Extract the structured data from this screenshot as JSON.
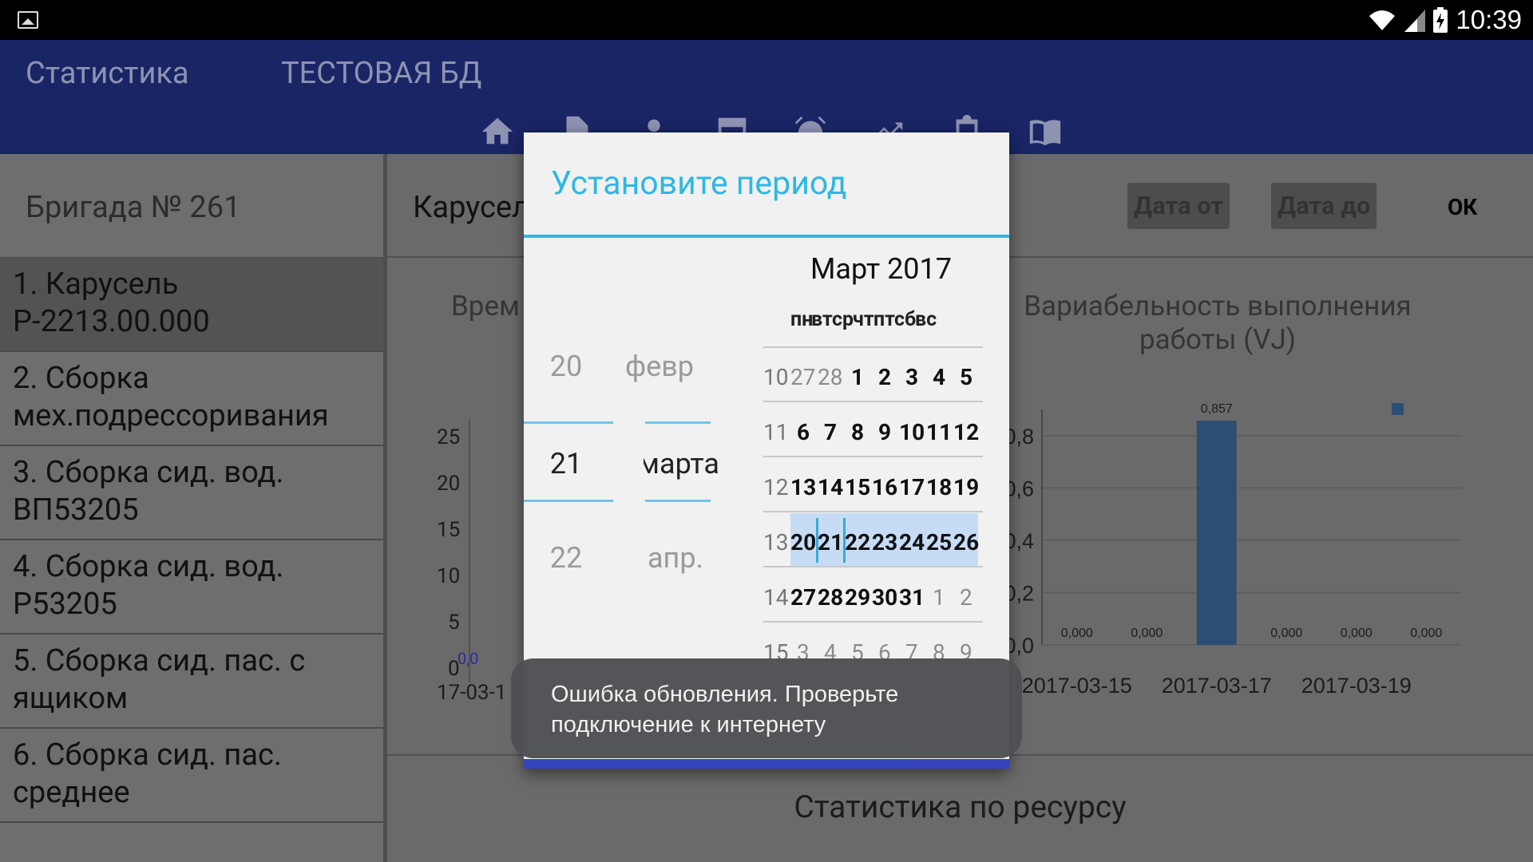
{
  "status_bar": {
    "time": "10:39",
    "icons": [
      "gallery-icon",
      "wifi-icon",
      "signal-icon",
      "battery-charging-icon"
    ]
  },
  "app_bar": {
    "title": "Статистика",
    "db_name": "ТЕСТОВАЯ БД",
    "nav_icons": [
      "home-icon",
      "document-icon",
      "person-icon",
      "window-icon",
      "alarm-icon",
      "trending-up-icon",
      "clipboard-icon",
      "book-icon"
    ]
  },
  "sidebar": {
    "brigade": "Бригада № 261",
    "items": [
      {
        "line1": "1. Карусель",
        "line2": "Р-2213.00.000"
      },
      {
        "line1": "2. Сборка",
        "line2": "мех.подрессоривания"
      },
      {
        "line1": "3. Сборка сид. вод.",
        "line2": "ВП53205"
      },
      {
        "line1": "4. Сборка сид. вод.",
        "line2": "Р53205"
      },
      {
        "line1": "5. Сборка сид. пас. с",
        "line2": "ящиком"
      },
      {
        "line1": "6. Сборка сид. пас.",
        "line2": "среднее"
      }
    ]
  },
  "content": {
    "header": "Карусел",
    "date_from_button": "Дата от",
    "date_to_button": "Дата до",
    "ok_button": "ОК",
    "footer_title": "Статистика по ресурсу",
    "colors": {
      "bar": "#2c4e74",
      "marker": "#2c4e74"
    }
  },
  "chart_data": [
    {
      "type": "bar",
      "title": "Врем",
      "y_ticks": [
        "25",
        "20",
        "15",
        "10",
        "5",
        "0"
      ],
      "x_labels": [
        "17-03-1"
      ],
      "data_labels": [
        "0,0"
      ]
    },
    {
      "type": "bar",
      "title": "Вариабельность выполнения работы (VJ)",
      "y_ticks": [
        "0,8",
        "0,6",
        "0,4",
        "0,2",
        "0,0"
      ],
      "ylim": [
        0,
        0.9
      ],
      "categories": [
        "2017-03-15",
        "2017-03-16",
        "2017-03-17",
        "2017-03-18",
        "2017-03-19",
        "2017-03-20"
      ],
      "x_labels": [
        "2017-03-15",
        "2017-03-17",
        "2017-03-19"
      ],
      "values": [
        0.0,
        0.0,
        0.857,
        0.0,
        0.0,
        0.0
      ],
      "data_labels": [
        "0,000",
        "0,000",
        "0,857",
        "0,000",
        "0,000",
        "0,000"
      ]
    }
  ],
  "dialog": {
    "title": "Установите период",
    "day_picker": {
      "prev": "20",
      "current": "21",
      "next": "22"
    },
    "month_picker": {
      "prev": "февр",
      "current": "марта",
      "next": "апр."
    },
    "calendar": {
      "month_label": "Март 2017",
      "weekdays": [
        "пн",
        "вт",
        "ср",
        "чт",
        "пт",
        "сб",
        "вс"
      ],
      "weeks": [
        {
          "num": "10",
          "days": [
            "27",
            "28",
            "1",
            "2",
            "3",
            "4",
            "5"
          ],
          "dim": [
            true,
            true,
            false,
            false,
            false,
            false,
            false
          ]
        },
        {
          "num": "11",
          "days": [
            "6",
            "7",
            "8",
            "9",
            "10",
            "11",
            "12"
          ],
          "dim": [
            false,
            false,
            false,
            false,
            false,
            false,
            false
          ]
        },
        {
          "num": "12",
          "days": [
            "13",
            "14",
            "15",
            "16",
            "17",
            "18",
            "19"
          ],
          "dim": [
            false,
            false,
            false,
            false,
            false,
            false,
            false
          ]
        },
        {
          "num": "13",
          "days": [
            "20",
            "21",
            "22",
            "23",
            "24",
            "25",
            "26"
          ],
          "dim": [
            false,
            false,
            false,
            false,
            false,
            false,
            false
          ]
        },
        {
          "num": "14",
          "days": [
            "27",
            "28",
            "29",
            "30",
            "31",
            "1",
            "2"
          ],
          "dim": [
            false,
            false,
            false,
            false,
            false,
            true,
            true
          ]
        },
        {
          "num": "15",
          "days": [
            "3",
            "4",
            "5",
            "6",
            "7",
            "8",
            "9"
          ],
          "dim": [
            true,
            true,
            true,
            true,
            true,
            true,
            true
          ]
        }
      ],
      "selected_week": "13",
      "selected_day": "21"
    }
  },
  "toast": {
    "line1": "Ошибка обновления. Проверьте",
    "line2": "подключение к интернету"
  }
}
